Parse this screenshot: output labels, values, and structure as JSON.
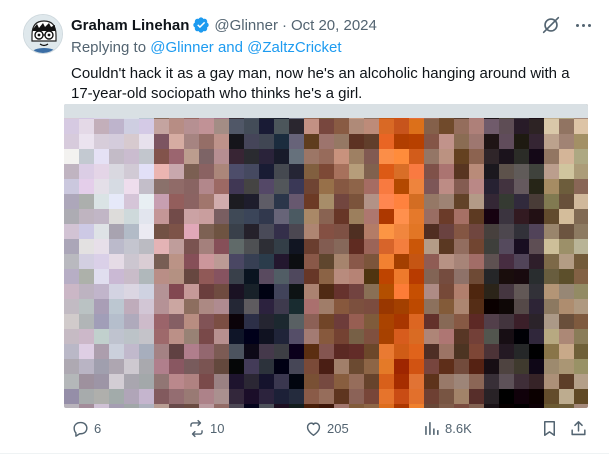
{
  "tweet": {
    "author_name": "Graham Linehan",
    "handle": "@Glinner",
    "separator": "·",
    "date": "Oct 20, 2024",
    "replying_prefix": "Replying to",
    "reply_targets": "@Glinner and @ZaltzCricket",
    "text": "Couldn't hack it as a gay man, now he's an alcoholic hanging around with a 17-year-old sociopath who thinks he's a girl."
  },
  "actions": {
    "replies": "6",
    "reposts": "10",
    "likes": "205",
    "views": "8.6K"
  },
  "icons": {
    "verified": "verified-badge-icon",
    "grok": "grok-icon",
    "more": "more-icon",
    "reply": "reply-icon",
    "repost": "repost-icon",
    "like": "like-icon",
    "views": "views-icon",
    "bookmark": "bookmark-icon",
    "share": "share-icon"
  },
  "colors": {
    "text": "#0f1419",
    "secondary": "#536471",
    "link": "#1d9bf0",
    "verified": "#1d9bf0"
  }
}
